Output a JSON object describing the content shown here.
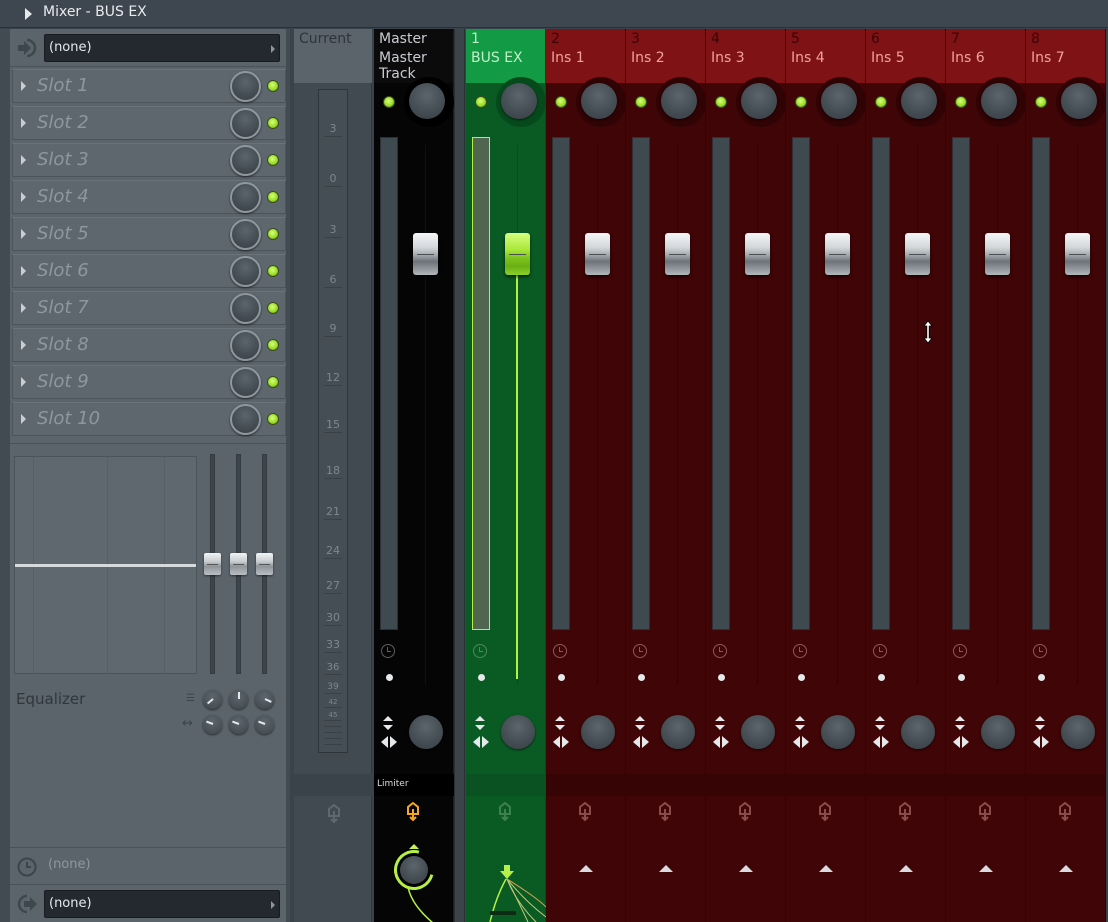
{
  "window": {
    "title": "Mixer - BUS EX"
  },
  "left_panel": {
    "input": {
      "value": "(none)"
    },
    "slots": [
      {
        "label": "Slot 1",
        "enabled": true
      },
      {
        "label": "Slot 2",
        "enabled": true
      },
      {
        "label": "Slot 3",
        "enabled": true
      },
      {
        "label": "Slot 4",
        "enabled": true
      },
      {
        "label": "Slot 5",
        "enabled": true
      },
      {
        "label": "Slot 6",
        "enabled": true
      },
      {
        "label": "Slot 7",
        "enabled": true
      },
      {
        "label": "Slot 8",
        "enabled": true
      },
      {
        "label": "Slot 9",
        "enabled": true
      },
      {
        "label": "Slot 10",
        "enabled": true
      }
    ],
    "equalizer": {
      "label": "Equalizer",
      "bands": 3
    },
    "latency": {
      "value": "(none)"
    },
    "output": {
      "value": "(none)"
    }
  },
  "current": {
    "label": "Current",
    "meter_ticks": [
      "3",
      "0",
      "3",
      "6",
      "9",
      "12",
      "15",
      "18",
      "21",
      "24",
      "27",
      "30",
      "33",
      "36",
      "39",
      "42",
      "45"
    ]
  },
  "tracks": [
    {
      "id": "master",
      "number": "Master",
      "name": "Master Track",
      "type": "master",
      "fx_label": "Limiter"
    },
    {
      "id": "bus-ex",
      "number": "1",
      "name": "BUS EX",
      "type": "bus",
      "selected": true
    },
    {
      "id": "ins-1",
      "number": "2",
      "name": "Ins 1",
      "type": "insert"
    },
    {
      "id": "ins-2",
      "number": "3",
      "name": "Ins 2",
      "type": "insert"
    },
    {
      "id": "ins-3",
      "number": "4",
      "name": "Ins 3",
      "type": "insert"
    },
    {
      "id": "ins-4",
      "number": "5",
      "name": "Ins 4",
      "type": "insert"
    },
    {
      "id": "ins-5",
      "number": "6",
      "name": "Ins 5",
      "type": "insert"
    },
    {
      "id": "ins-6",
      "number": "7",
      "name": "Ins 6",
      "type": "insert"
    },
    {
      "id": "ins-7",
      "number": "8",
      "name": "Ins 7",
      "type": "insert"
    }
  ],
  "colors": {
    "master": "#050505",
    "bus": "#0a5a24",
    "bus_header": "#139a44",
    "insert": "#400506",
    "insert_header": "#7e1214",
    "led_on": "#9adf2a",
    "accent_green": "#b6f046",
    "route_orange": "#f5a623"
  }
}
